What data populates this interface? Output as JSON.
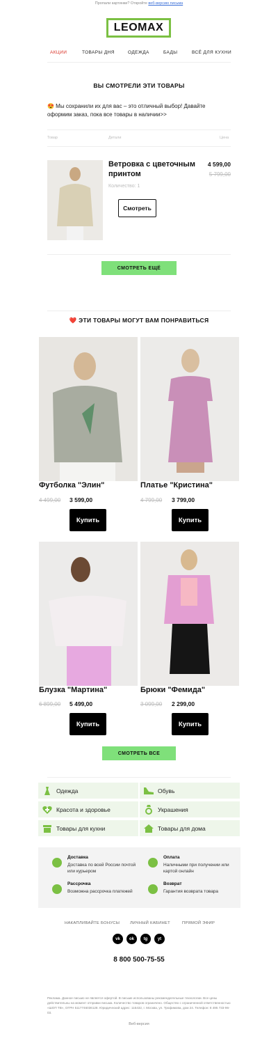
{
  "header": {
    "preheader_text": "Пропали картинки? Откройте",
    "preheader_link": "веб-версию письма",
    "logo_text": "LEOMAX",
    "nav": [
      {
        "label": "АКЦИИ"
      },
      {
        "label": "ТОВАРЫ ДНЯ"
      },
      {
        "label": "ОДЕЖДА"
      },
      {
        "label": "БАДЫ"
      },
      {
        "label": "ВСЁ ДЛЯ КУХНИ"
      }
    ]
  },
  "viewed": {
    "title": "ВЫ СМОТРЕЛИ ЭТИ ТОВАРЫ",
    "intro": "😍 Мы сохранили их для вас – это отличный выбор! Давайте оформим заказ, пока все товары в наличии>>",
    "columns": [
      "Товар",
      "Детали",
      "Цена"
    ],
    "product": {
      "name": "Ветровка с цветочным принтом",
      "price": "4 599,00",
      "old_price": "5 799,00",
      "quantity": "Количество: 1",
      "button": "Смотреть"
    },
    "more_button": "СМОТРЕТЬ ЕЩЁ"
  },
  "recommend": {
    "title": "❤️ ЭТИ ТОВАРЫ МОГУТ ВАМ ПОНРАВИТЬСЯ",
    "products": [
      {
        "name": "Футболка \"Элин\"",
        "old_price": "4 499,00",
        "price": "3 599,00",
        "button": "Купить",
        "img": "#e8e6e2",
        "clothes": "#a8aca0"
      },
      {
        "name": "Платье \"Кристина\"",
        "old_price": "4 799,00",
        "price": "3 799,00",
        "button": "Купить",
        "img": "#ecebe9",
        "clothes": "#c98fb8"
      },
      {
        "name": "Блузка \"Мартина\"",
        "old_price": "6 899,00",
        "price": "5 499,00",
        "button": "Купить",
        "img": "#ecebea",
        "clothes": "#f3eef0"
      },
      {
        "name": "Брюки \"Фемида\"",
        "old_price": "3 099,00",
        "price": "2 299,00",
        "button": "Купить",
        "img": "#eceae8",
        "clothes": "#e39ed2"
      }
    ],
    "all_button": "СМОТРЕТЬ ВСЕ"
  },
  "categories": [
    {
      "label": "Одежда",
      "icon": "dress-icon"
    },
    {
      "label": "Обувь",
      "icon": "shoe-icon"
    },
    {
      "label": "Красота и здоровье",
      "icon": "heart-plus-icon"
    },
    {
      "label": "Украшения",
      "icon": "ring-icon"
    },
    {
      "label": "Товары для кухни",
      "icon": "pot-icon"
    },
    {
      "label": "Товары для дома",
      "icon": "house-icon"
    }
  ],
  "info": [
    {
      "title": "Доставка",
      "desc": "Доставка по всей России почтой или курьером",
      "icon": "box-icon"
    },
    {
      "title": "Оплата",
      "desc": "Наличными при получении или картой онлайн",
      "icon": "ruble-icon"
    },
    {
      "title": "Рассрочка",
      "desc": "Возможна рассрочка платежей",
      "icon": "clock-icon"
    },
    {
      "title": "Возврат",
      "desc": "Гарантия возврата товара",
      "icon": "return-icon"
    }
  ],
  "footer": {
    "links": [
      "НАКАПЛИВАЙТЕ БОНУСЫ",
      "ЛИЧНЫЙ КАБИНЕТ",
      "ПРЯМОЙ ЭФИР"
    ],
    "social": [
      {
        "label": "vk",
        "icon": "vk-icon"
      },
      {
        "label": "ok",
        "icon": "ok-icon"
      },
      {
        "label": "tg",
        "icon": "telegram-icon"
      },
      {
        "label": "yt",
        "icon": "youtube-icon"
      }
    ],
    "phone": "8 800 500-75-55",
    "legal": "Реклама. Данное письмо не является офертой. В письме использованы рекомендательные технологии. Все цены действительны на момент отправки письма. Количество товаров ограничено. Общество с ограниченной ответственностью «ШОП ТВ», ОГРН 5117746036128. Юридический адрес: 115432, г. Москва, ул. Трофимова, дом 24. Телефон: 8 495 733-96-03.",
    "web_version": "Веб-версия"
  },
  "colors": {
    "accent_green": "#7fe07a",
    "logo_border": "#7bc043",
    "nav_active": "#d93025",
    "category_bg": "#eef6ea"
  }
}
